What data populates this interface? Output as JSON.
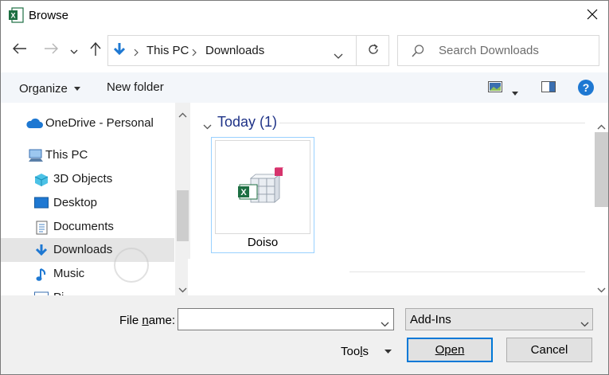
{
  "window": {
    "title": "Browse",
    "app_icon": "excel-icon",
    "close_icon": "close-icon"
  },
  "nav": {
    "back_icon": "back-arrow-icon",
    "forward_icon": "forward-arrow-icon",
    "recent_icon": "chevron-down-icon",
    "up_icon": "up-arrow-icon",
    "address": {
      "location_icon": "downloads-icon",
      "crumbs": [
        "This PC",
        "Downloads"
      ],
      "dropdown_icon": "chevron-down-icon",
      "refresh_icon": "refresh-icon"
    },
    "search": {
      "placeholder": "Search Downloads",
      "icon": "search-icon"
    }
  },
  "toolbar": {
    "organize_label": "Organize",
    "new_folder_label": "New folder",
    "view_icon": "view-icon",
    "preview_icon": "preview-pane-icon",
    "help_icon": "help-icon"
  },
  "sidebar": {
    "items": [
      {
        "label": "OneDrive - Personal",
        "icon": "cloud-icon",
        "selected": false
      },
      {
        "label": "This PC",
        "icon": "computer-icon",
        "selected": false
      },
      {
        "label": "3D Objects",
        "icon": "cube-icon",
        "selected": false
      },
      {
        "label": "Desktop",
        "icon": "desktop-icon",
        "selected": false
      },
      {
        "label": "Documents",
        "icon": "document-icon",
        "selected": false
      },
      {
        "label": "Downloads",
        "icon": "downloads-icon",
        "selected": true
      },
      {
        "label": "Music",
        "icon": "music-icon",
        "selected": false
      },
      {
        "label": "Pi",
        "icon": "pictures-icon",
        "selected": false
      }
    ]
  },
  "content": {
    "group_title": "Today (1)",
    "files": [
      {
        "name": "Doiso",
        "icon": "excel-addin-icon"
      }
    ]
  },
  "bottom": {
    "file_name_label_pre": "File ",
    "file_name_label_u": "n",
    "file_name_label_post": "ame:",
    "file_name_value": "",
    "filter_value": "Add-Ins",
    "tools_label_pre": "Too",
    "tools_label_u": "l",
    "tools_label_post": "s",
    "open_label": "Open",
    "cancel_label": "Cancel"
  },
  "colors": {
    "accent": "#0078d7",
    "selection": "#e5e5e5",
    "group_title": "#1e3287",
    "toolbar_bg": "#f3f6fa"
  }
}
